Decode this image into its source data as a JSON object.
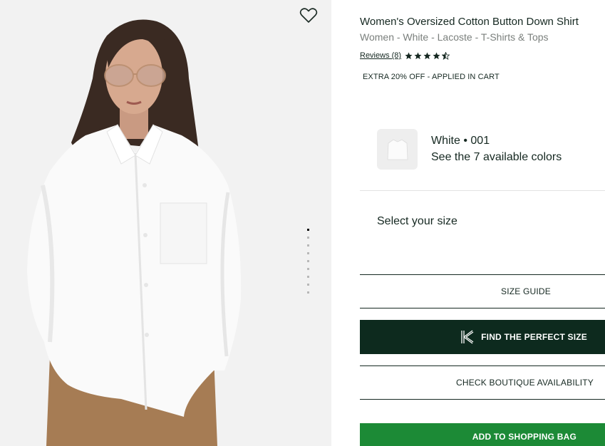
{
  "product": {
    "title": "Women's Oversized Cotton Button Down Shirt",
    "subtitle": "Women - White - Lacoste - T-Shirts & Tops",
    "reviews_label": "Reviews (8)",
    "rating": 4.5,
    "rating_max": 5,
    "promo": "EXTRA 20% OFF - APPLIED IN CART"
  },
  "color": {
    "name": "White • 001",
    "link": "See the 7 available colors"
  },
  "size": {
    "label": "Select your size"
  },
  "buttons": {
    "size_guide": "SIZE GUIDE",
    "perfect_size": "FIND THE PERFECT SIZE",
    "boutique": "CHECK BOUTIQUE AVAILABILITY",
    "add_to_bag": "ADD TO SHOPPING BAG"
  },
  "gallery": {
    "image_count": 9,
    "active_index": 0
  },
  "icons": {
    "wishlist": "heart-outline-icon",
    "star": "star-icon",
    "fit": "fit-predictor-k-icon"
  },
  "colors": {
    "brand_dark": "#0d2a1e",
    "cta_green": "#1c8a36",
    "text": "#152821",
    "muted": "#7a7f7c"
  }
}
